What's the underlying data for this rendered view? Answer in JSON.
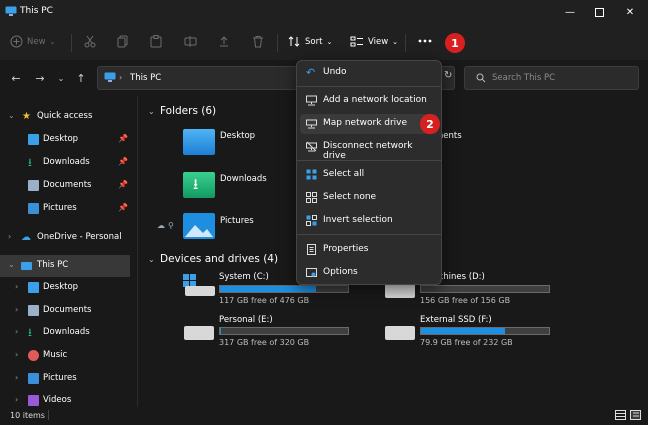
{
  "window": {
    "title": "This PC"
  },
  "toolbar": {
    "new_label": "New",
    "sort_label": "Sort",
    "view_label": "View"
  },
  "address": {
    "path": "This PC"
  },
  "search": {
    "placeholder": "Search This PC"
  },
  "sidebar": {
    "items": [
      {
        "label": "Quick access"
      },
      {
        "label": "Desktop"
      },
      {
        "label": "Downloads"
      },
      {
        "label": "Documents"
      },
      {
        "label": "Pictures"
      },
      {
        "label": "OneDrive - Personal"
      },
      {
        "label": "This PC"
      },
      {
        "label": "Desktop"
      },
      {
        "label": "Documents"
      },
      {
        "label": "Downloads"
      },
      {
        "label": "Music"
      },
      {
        "label": "Pictures"
      },
      {
        "label": "Videos"
      }
    ]
  },
  "folders": {
    "header": "Folders (6)",
    "items": [
      {
        "label": "Desktop"
      },
      {
        "label": "Downloads"
      },
      {
        "label": "Pictures"
      },
      {
        "label": "ments"
      },
      {
        "label": "s"
      }
    ]
  },
  "drives": {
    "header": "Devices and drives (4)",
    "items": [
      {
        "label": "System (C:)",
        "free": "117 GB free of 476 GB",
        "used_fraction": 0.75
      },
      {
        "label": "l Machines (D:)",
        "free": "156 GB free of 156 GB",
        "used_fraction": 0.0
      },
      {
        "label": "Personal (E:)",
        "free": "317 GB free of 320 GB",
        "used_fraction": 0.01
      },
      {
        "label": "External SSD (F:)",
        "free": "79.9 GB free of 232 GB",
        "used_fraction": 0.66
      }
    ]
  },
  "menu": {
    "items": [
      {
        "label": "Undo"
      },
      {
        "label": "Add a network location"
      },
      {
        "label": "Map network drive"
      },
      {
        "label": "Disconnect network drive"
      },
      {
        "label": "Select all"
      },
      {
        "label": "Select none"
      },
      {
        "label": "Invert selection"
      },
      {
        "label": "Properties"
      },
      {
        "label": "Options"
      }
    ]
  },
  "annotations": {
    "badge1": "1",
    "badge2": "2"
  },
  "status": {
    "count": "10 items"
  },
  "colors": {
    "accent": "#1e8fe0",
    "badge": "#d92020",
    "background": "#191919"
  }
}
